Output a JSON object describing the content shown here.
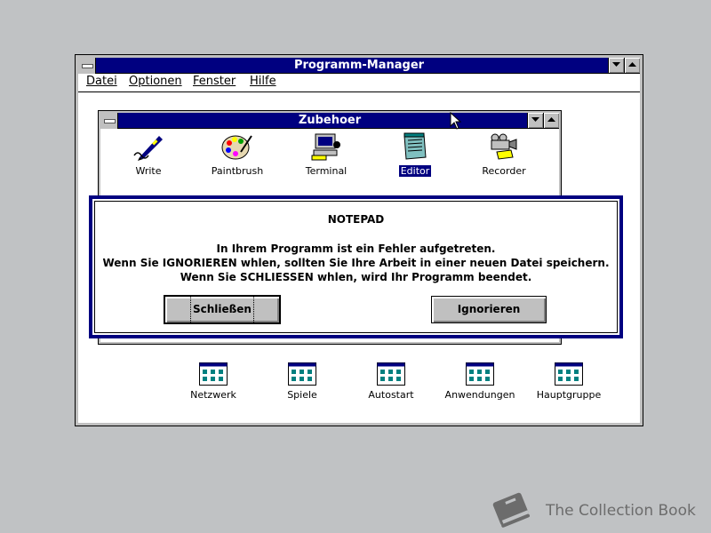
{
  "program_manager": {
    "title": "Programm-Manager",
    "menu": [
      "Datei",
      "Optionen",
      "Fenster",
      "Hilfe"
    ]
  },
  "group_window": {
    "title": "Zubehoer",
    "icons": [
      {
        "label": "Write",
        "icon": "write-pen-icon"
      },
      {
        "label": "Paintbrush",
        "icon": "paint-palette-icon"
      },
      {
        "label": "Terminal",
        "icon": "terminal-computer-icon"
      },
      {
        "label": "Editor",
        "icon": "notepad-icon",
        "selected": true
      },
      {
        "label": "Recorder",
        "icon": "video-camera-icon"
      }
    ]
  },
  "program_groups": [
    {
      "label": "Netzwerk"
    },
    {
      "label": "Spiele"
    },
    {
      "label": "Autostart"
    },
    {
      "label": "Anwendungen"
    },
    {
      "label": "Hauptgruppe"
    }
  ],
  "dialog": {
    "title": "NOTEPAD",
    "lines": [
      "In Ihrem Programm ist ein Fehler aufgetreten.",
      "Wenn Sie IGNORIEREN whlen, sollten Sie Ihre Arbeit in einer neuen Datei speichern.",
      "Wenn Sie SCHLIESSEN whlen, wird Ihr Programm beendet."
    ],
    "close_label": "Schließen",
    "ignore_label": "Ignorieren"
  },
  "watermark": {
    "text": "The Collection Book"
  },
  "colors": {
    "titlebar": "#000080",
    "desktop": "#c0c2c4",
    "face": "#c0c0c0"
  }
}
